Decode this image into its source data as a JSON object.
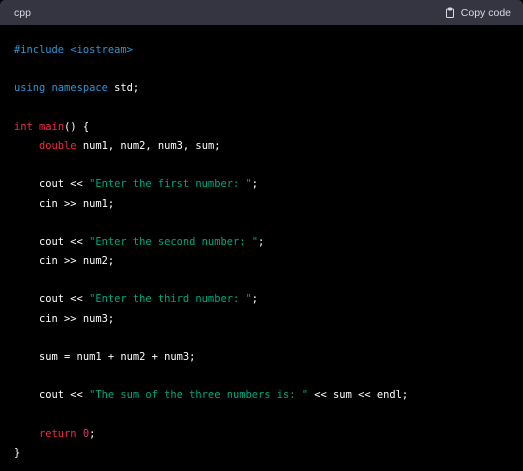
{
  "header": {
    "language": "cpp",
    "copy_label": "Copy code",
    "copy_icon": "clipboard-icon"
  },
  "colors": {
    "background": "#000000",
    "header_bg": "#343541",
    "keyword": "#2e95d3",
    "type": "#f22c3d",
    "string": "#00a67d",
    "number": "#df3079",
    "plain": "#ffffff"
  },
  "code_lines": [
    [
      {
        "t": "#include ",
        "c": "pre"
      },
      {
        "t": "<iostream>",
        "c": "pre"
      }
    ],
    [],
    [
      {
        "t": "using",
        "c": "kw"
      },
      {
        "t": " ",
        "c": "plain"
      },
      {
        "t": "namespace",
        "c": "kw"
      },
      {
        "t": " std;",
        "c": "plain"
      }
    ],
    [],
    [
      {
        "t": "int",
        "c": "type"
      },
      {
        "t": " ",
        "c": "plain"
      },
      {
        "t": "main",
        "c": "fn"
      },
      {
        "t": "() {",
        "c": "plain"
      }
    ],
    [
      {
        "t": "    ",
        "c": "plain"
      },
      {
        "t": "double",
        "c": "type"
      },
      {
        "t": " num1, num2, num3, sum;",
        "c": "plain"
      }
    ],
    [],
    [
      {
        "t": "    cout << ",
        "c": "plain"
      },
      {
        "t": "\"Enter the first number: \"",
        "c": "str"
      },
      {
        "t": ";",
        "c": "plain"
      }
    ],
    [
      {
        "t": "    cin >> num1;",
        "c": "plain"
      }
    ],
    [],
    [
      {
        "t": "    cout << ",
        "c": "plain"
      },
      {
        "t": "\"Enter the second number: \"",
        "c": "str"
      },
      {
        "t": ";",
        "c": "plain"
      }
    ],
    [
      {
        "t": "    cin >> num2;",
        "c": "plain"
      }
    ],
    [],
    [
      {
        "t": "    cout << ",
        "c": "plain"
      },
      {
        "t": "\"Enter the third number: \"",
        "c": "str"
      },
      {
        "t": ";",
        "c": "plain"
      }
    ],
    [
      {
        "t": "    cin >> num3;",
        "c": "plain"
      }
    ],
    [],
    [
      {
        "t": "    sum = num1 + num2 + num3;",
        "c": "plain"
      }
    ],
    [],
    [
      {
        "t": "    cout << ",
        "c": "plain"
      },
      {
        "t": "\"The sum of the three numbers is: \"",
        "c": "str"
      },
      {
        "t": " << sum << endl;",
        "c": "plain"
      }
    ],
    [],
    [
      {
        "t": "    ",
        "c": "plain"
      },
      {
        "t": "return",
        "c": "type"
      },
      {
        "t": " ",
        "c": "plain"
      },
      {
        "t": "0",
        "c": "num"
      },
      {
        "t": ";",
        "c": "plain"
      }
    ],
    [
      {
        "t": "}",
        "c": "plain"
      }
    ]
  ]
}
